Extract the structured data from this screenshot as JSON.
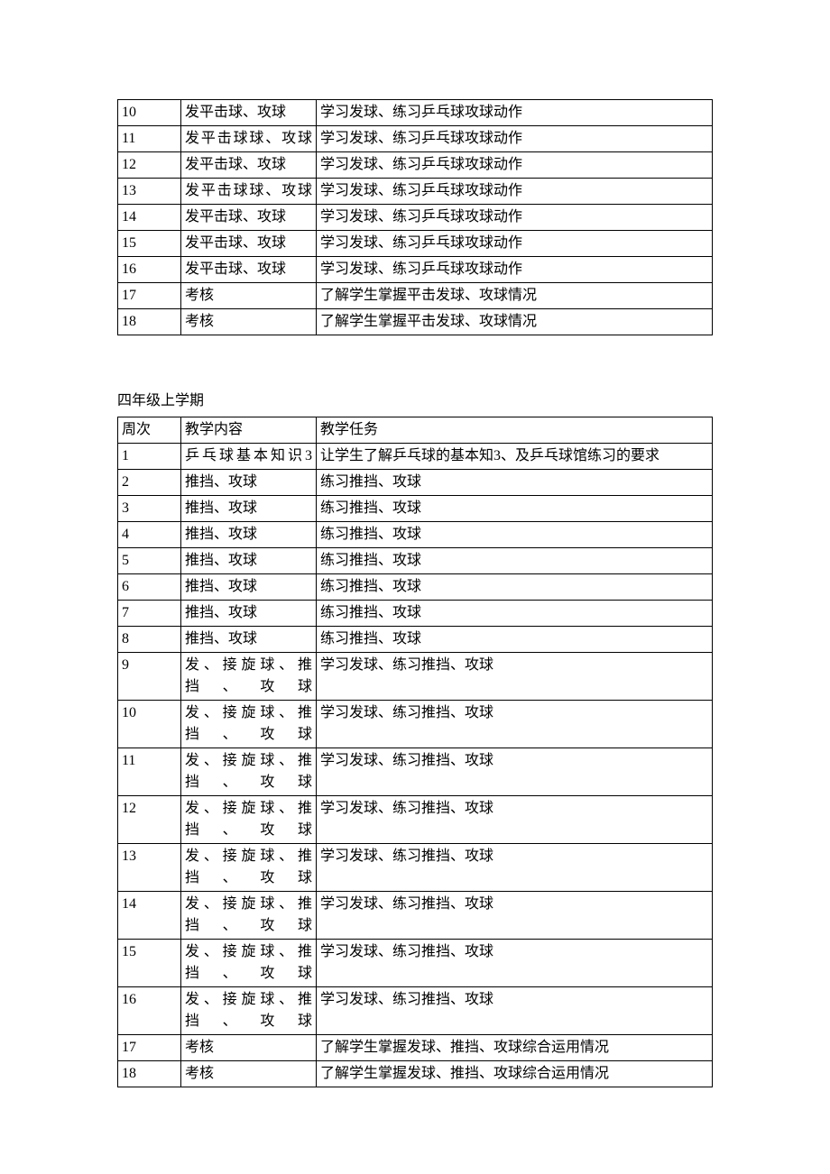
{
  "table1": {
    "rows": [
      {
        "week": "10",
        "content": "发平击球、攻球",
        "task": "学习发球、练习乒乓球攻球动作"
      },
      {
        "week": "11",
        "content": "发平击球球、攻球",
        "task": "学习发球、练习乒乓球攻球动作"
      },
      {
        "week": "12",
        "content": "发平击球、攻球",
        "task": "学习发球、练习乒乓球攻球动作"
      },
      {
        "week": "13",
        "content": "发平击球球、攻球",
        "task": "学习发球、练习乒乓球攻球动作"
      },
      {
        "week": "14",
        "content": "发平击球、攻球",
        "task": "学习发球、练习乒乓球攻球动作"
      },
      {
        "week": "15",
        "content": "发平击球、攻球",
        "task": "学习发球、练习乒乓球攻球动作"
      },
      {
        "week": "16",
        "content": "发平击球、攻球",
        "task": "学习发球、练习乒乓球攻球动作"
      },
      {
        "week": "17",
        "content": "考核",
        "task": "了解学生掌握平击发球、攻球情况"
      },
      {
        "week": "18",
        "content": "考核",
        "task": "了解学生掌握平击发球、攻球情况"
      }
    ]
  },
  "section2": {
    "title": "四年级上学期",
    "header": {
      "week": "周次",
      "content": "教学内容",
      "task": "教学任务"
    },
    "rows": [
      {
        "week": "1",
        "content": "乒乓球基本知识3",
        "task": "让学生了解乒乓球的基本知3、及乒乓球馆练习的要求"
      },
      {
        "week": "2",
        "content": "推挡、攻球",
        "task": "练习推挡、攻球"
      },
      {
        "week": "3",
        "content": "推挡、攻球",
        "task": "练习推挡、攻球"
      },
      {
        "week": "4",
        "content": "推挡、攻球",
        "task": "练习推挡、攻球"
      },
      {
        "week": "5",
        "content": "推挡、攻球",
        "task": "练习推挡、攻球"
      },
      {
        "week": "6",
        "content": "推挡、攻球",
        "task": "练习推挡、攻球"
      },
      {
        "week": "7",
        "content": "推挡、攻球",
        "task": "练习推挡、攻球"
      },
      {
        "week": "8",
        "content": "推挡、攻球",
        "task": "练习推挡、攻球"
      },
      {
        "week": "9",
        "content": "发、接旋球、推挡、攻球",
        "task": "学习发球、练习推挡、攻球"
      },
      {
        "week": "10",
        "content": "发、接旋球、推挡、攻球",
        "task": "学习发球、练习推挡、攻球"
      },
      {
        "week": "11",
        "content": "发、接旋球、推挡、攻球",
        "task": "学习发球、练习推挡、攻球"
      },
      {
        "week": "12",
        "content": "发、接旋球、推挡、攻球",
        "task": "学习发球、练习推挡、攻球"
      },
      {
        "week": "13",
        "content": "发、接旋球、推挡、攻球",
        "task": "学习发球、练习推挡、攻球"
      },
      {
        "week": "14",
        "content": "发、接旋球、推挡、攻球",
        "task": "学习发球、练习推挡、攻球"
      },
      {
        "week": "15",
        "content": "发、接旋球、推挡、攻球",
        "task": "学习发球、练习推挡、攻球"
      },
      {
        "week": "16",
        "content": "发、接旋球、推挡、攻球",
        "task": "学习发球、练习推挡、攻球"
      },
      {
        "week": "17",
        "content": "考核",
        "task": "了解学生掌握发球、推挡、攻球综合运用情况"
      },
      {
        "week": "18",
        "content": "考核",
        "task": "了解学生掌握发球、推挡、攻球综合运用情况"
      }
    ]
  }
}
